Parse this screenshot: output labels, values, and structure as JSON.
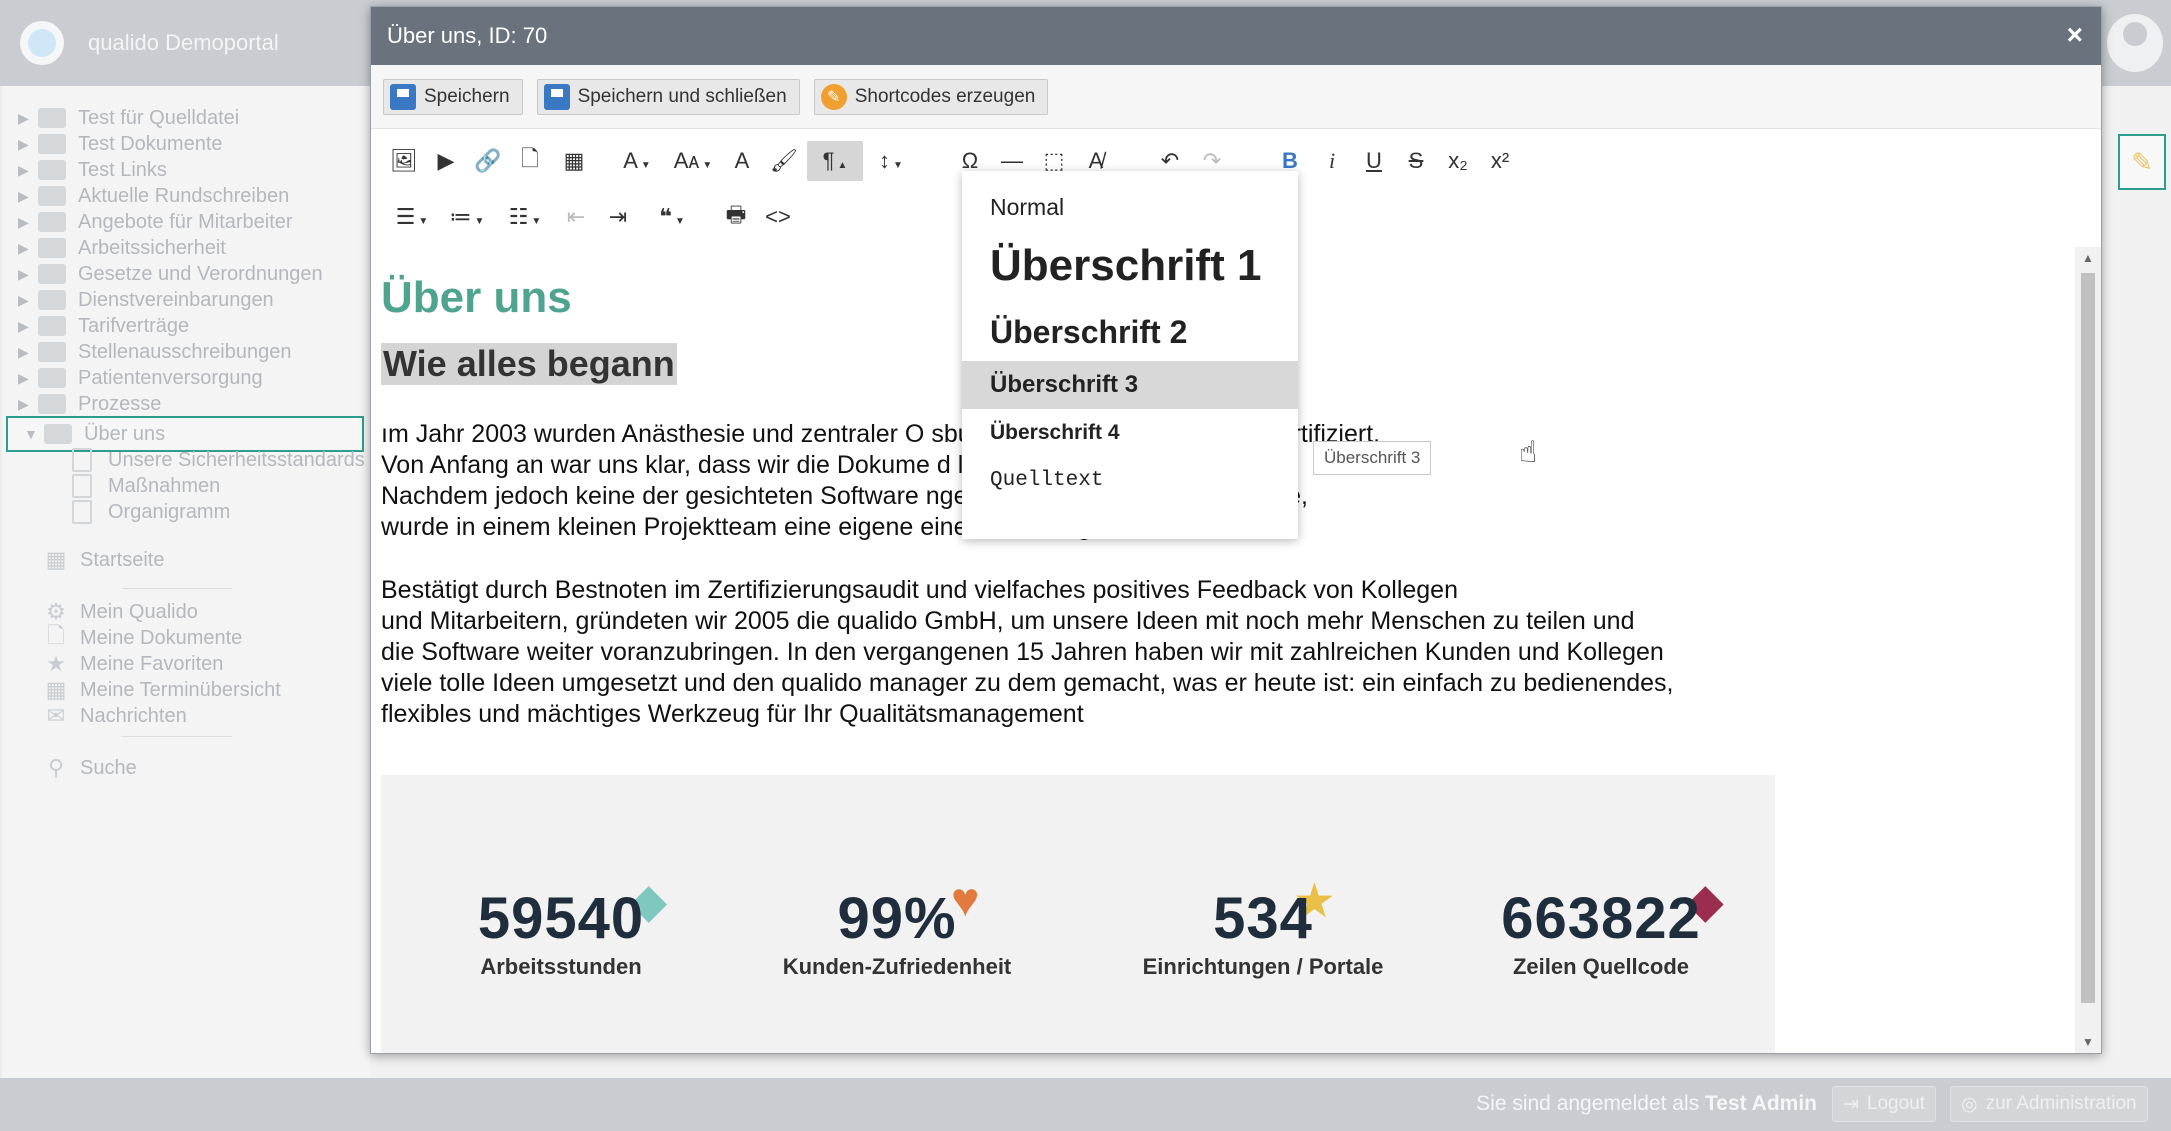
{
  "app": {
    "title": "qualido Demoportal",
    "sidebar": {
      "folders": [
        "Test für Quelldatei",
        "Test Dokumente",
        "Test Links",
        "Aktuelle Rundschreiben",
        "Angebote für Mitarbeiter",
        "Arbeitssicherheit",
        "Gesetze und Verordnungen",
        "Dienstvereinbarungen",
        "Tarifverträge",
        "Stellenausschreibungen",
        "Patientenversorgung",
        "Prozesse"
      ],
      "selected_folder": "Über uns",
      "children": [
        "Unsere Sicherheitsstandards",
        "Maßnahmen",
        "Organigramm"
      ],
      "start_link": "Startseite",
      "personal_links": [
        "Mein Qualido",
        "Meine Dokumente",
        "Meine Favoriten",
        "Meine Terminübersicht",
        "Nachrichten"
      ],
      "search_link": "Suche"
    },
    "footer": {
      "logged_in_prefix": "Sie sind angemeldet als",
      "user": "Test Admin",
      "logout": "Logout",
      "admin": "zur Administration"
    }
  },
  "modal": {
    "title": "Über uns, ID: 70",
    "close": "×",
    "buttons": {
      "save": "Speichern",
      "save_close": "Speichern und schließen",
      "shortcodes": "Shortcodes erzeugen"
    }
  },
  "editor": {
    "heading1": "Über uns",
    "heading2": "Wie alles begann",
    "paragraph1": "ım Jahr 2003 wurden Anästhesie und zentraler O                              sburg nach DIN EN ISO 9001 zertifiziert.\nVon Anfang an war uns klar, dass wir die Dokume                              d lenken würden können.\nNachdem jedoch keine der gesichteten Software                              ngen und Wünschen genügt hatte,\nwurde in einem kleinen Projektteam eine eigene                              eine Idee war geboren!",
    "paragraph2": "Bestätigt durch Bestnoten im Zertifizierungsaudit und vielfaches positives Feedback von Kollegen\nund Mitarbeitern, gründeten wir 2005 die qualido GmbH, um unsere Ideen mit noch mehr Menschen zu teilen und\ndie Software weiter voranzubringen. In den vergangenen 15 Jahren haben wir mit zahlreichen Kunden und Kollegen\nviele tolle Ideen umgesetzt und den qualido manager zu dem gemacht, was er heute ist: ein einfach zu bedienendes,\nflexibles und mächtiges Werkzeug für Ihr Qualitätsmanagement",
    "stats": [
      {
        "number": "59540",
        "label": "Arbeitsstunden"
      },
      {
        "number": "99%",
        "label": "Kunden-Zufriedenheit"
      },
      {
        "number": "534",
        "label": "Einrichtungen / Portale"
      },
      {
        "number": "663822",
        "label": "Zeilen Quellcode"
      }
    ]
  },
  "format_menu": {
    "items": [
      "Normal",
      "Überschrift 1",
      "Überschrift 2",
      "Überschrift 3",
      "Überschrift 4",
      "Quelltext"
    ],
    "hovered": "Überschrift 3",
    "tooltip": "Überschrift 3"
  },
  "colors": {
    "accent": "#2e9e8c",
    "heading_green": "#4ea48e",
    "titlebar": "#6a737d",
    "bold_blue": "#3a78c3"
  }
}
